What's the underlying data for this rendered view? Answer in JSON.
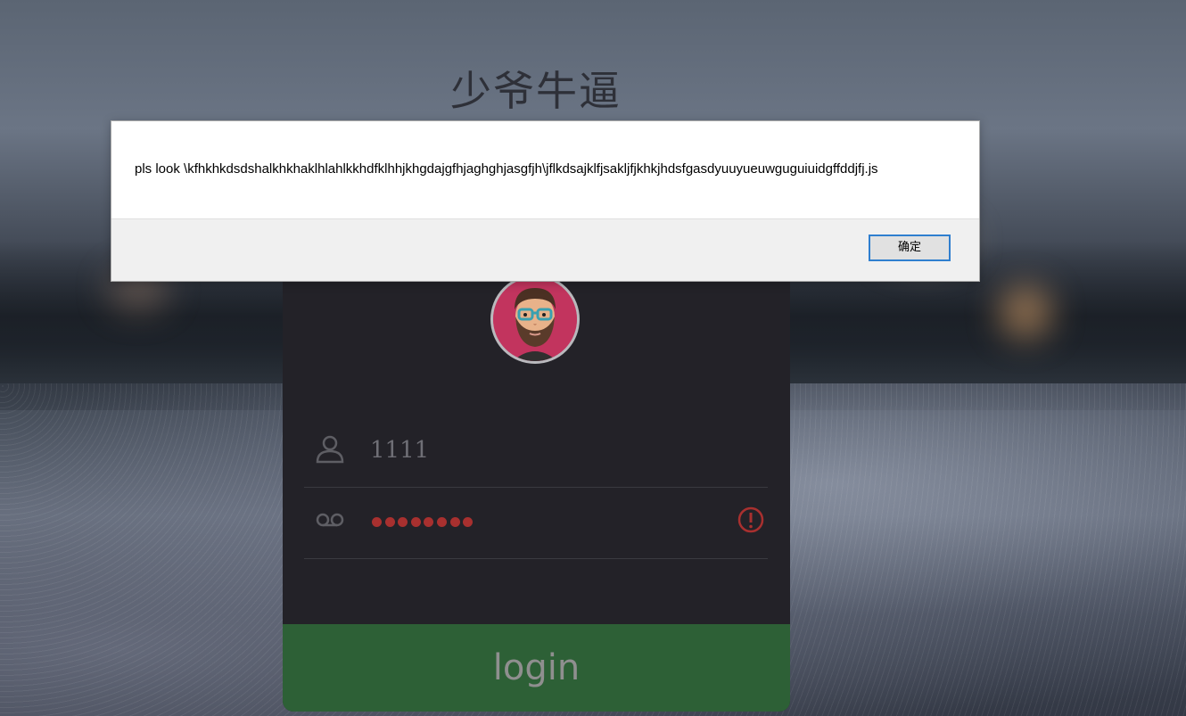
{
  "page": {
    "title": "少爷牛逼"
  },
  "login_form": {
    "username_value": "1111",
    "password_dot_count": 8,
    "login_label": "login",
    "user_icon": "user-icon",
    "password_icon": "voicemail-icon",
    "warning_icon": "warning-icon",
    "avatar": "bearded-man-with-glasses",
    "colors": {
      "card": "#232228",
      "login_button": "#2d6036",
      "warning": "#a8302f"
    }
  },
  "alert": {
    "message": "pls look \\kfhkhkdsdshalkhkhaklhlahlkkhdfklhhjkhgdajgfhjaghghjasgfjh\\jflkdsajklfjsakljfjkhkjhdsfgasdyuuyueuwguguiuidgffddjfj.js",
    "ok_label": "确定",
    "colors": {
      "button_border": "#2f7fcf"
    }
  }
}
